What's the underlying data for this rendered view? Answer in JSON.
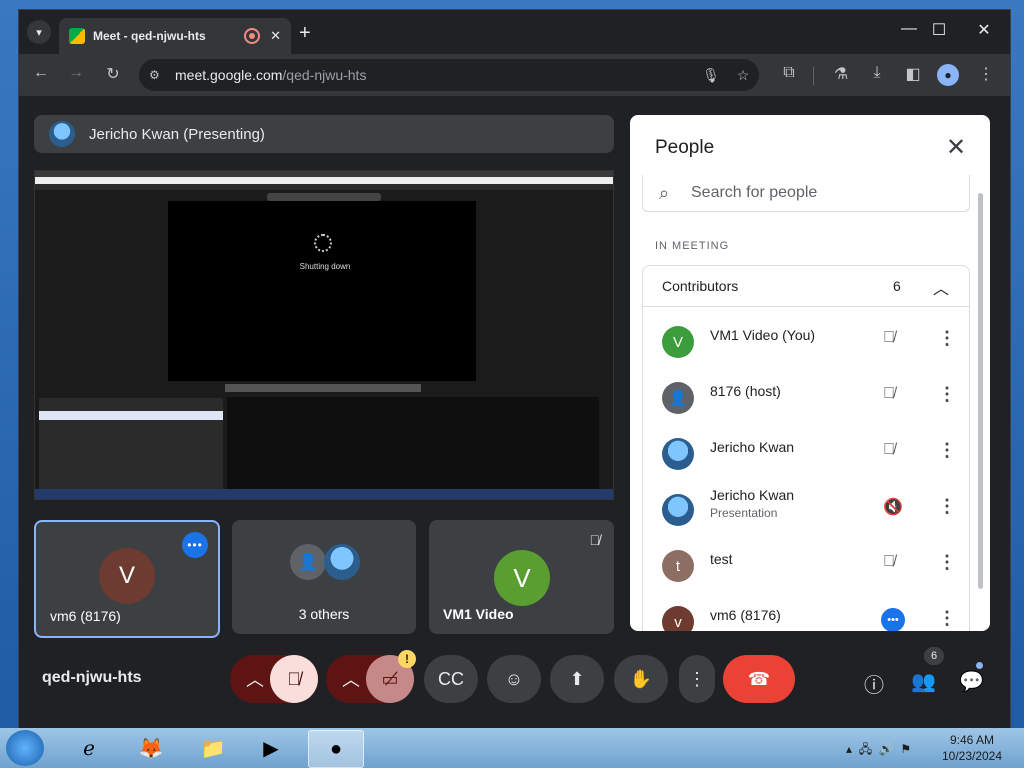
{
  "browser": {
    "tab_title": "Meet - qed-njwu-hts",
    "url_host": "meet.google.com",
    "url_path": "/qed-njwu-hts"
  },
  "presenter": {
    "label": "Jericho Kwan (Presenting)"
  },
  "shared_screen": {
    "status_text": "Shutting down"
  },
  "tiles": [
    {
      "name": "vm6 (8176)",
      "initial": "V"
    },
    {
      "name": "3 others"
    },
    {
      "name": "VM1 Video",
      "initial": "V"
    }
  ],
  "people_panel": {
    "title": "People",
    "search_placeholder": "Search for people",
    "section_label": "IN MEETING",
    "group_title": "Contributors",
    "group_count": "6",
    "people": [
      {
        "name": "VM1 Video (You)",
        "initial": "V",
        "color": "#3c9d3c"
      },
      {
        "name": "8176 (host)",
        "initial": "",
        "color": "#5f6368"
      },
      {
        "name": "Jericho Kwan",
        "initial": "",
        "color": "#2b5d8f"
      },
      {
        "name": "Jericho Kwan",
        "subtitle": "Presentation",
        "initial": "",
        "color": "#2b5d8f"
      },
      {
        "name": "test",
        "initial": "t",
        "color": "#8d6e63"
      },
      {
        "name": "vm6 (8176)",
        "initial": "v",
        "color": "#6d3b2f"
      }
    ]
  },
  "controls": {
    "meeting_code": "qed-njwu-hts",
    "people_badge": "6",
    "camera_warning": "!"
  },
  "taskbar": {
    "time": "9:46 AM",
    "date": "10/23/2024"
  },
  "colors": {
    "meet_bg": "#202124",
    "accent_blue": "#1a73e8",
    "hangup_red": "#ea4335"
  }
}
